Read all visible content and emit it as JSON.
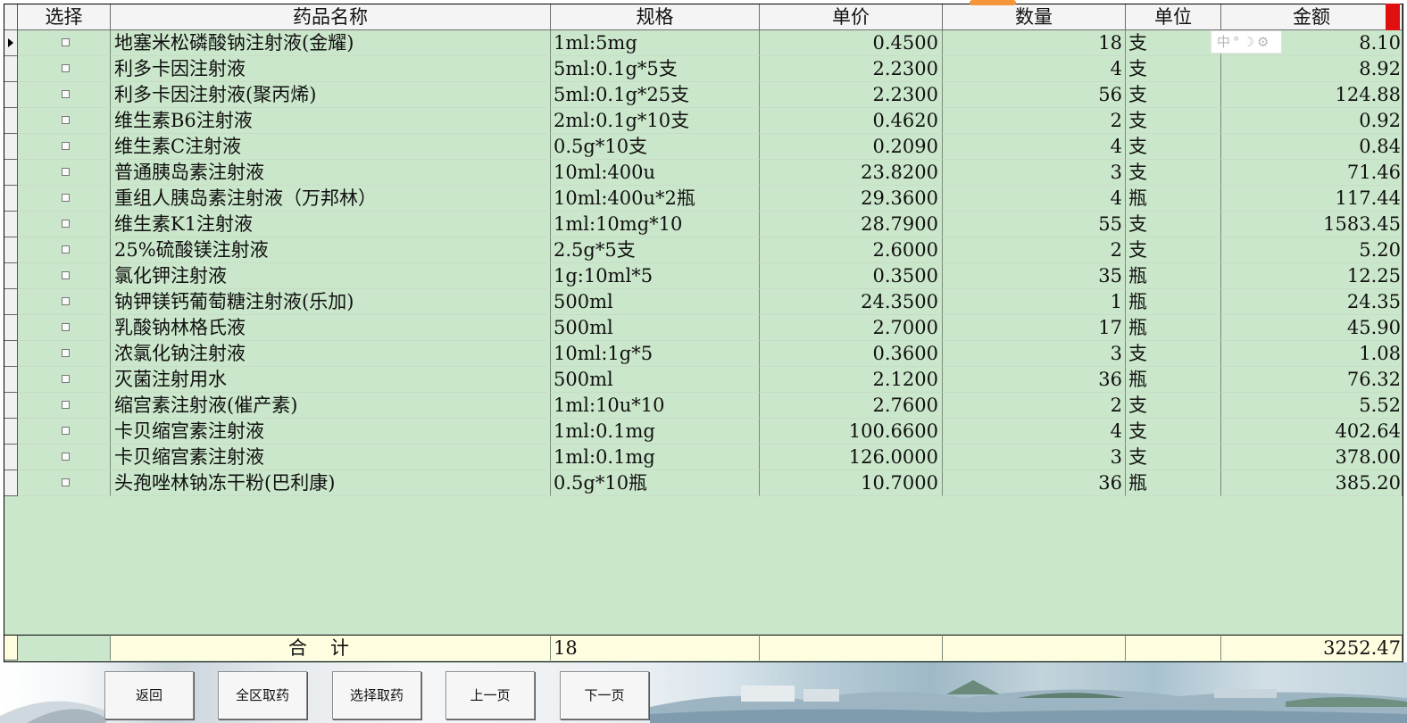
{
  "columns": {
    "select": "选择",
    "name": "药品名称",
    "spec": "规格",
    "price": "单价",
    "qty": "数量",
    "unit": "单位",
    "amount": "金额"
  },
  "rows": [
    {
      "name": "地塞米松磷酸钠注射液(金耀)",
      "spec": "1ml:5mg",
      "price": "0.4500",
      "qty": "18",
      "unit": "支",
      "amount": "8.10",
      "current": true
    },
    {
      "name": "利多卡因注射液",
      "spec": "5ml:0.1g*5支",
      "price": "2.2300",
      "qty": "4",
      "unit": "支",
      "amount": "8.92"
    },
    {
      "name": "利多卡因注射液(聚丙烯)",
      "spec": "5ml:0.1g*25支",
      "price": "2.2300",
      "qty": "56",
      "unit": "支",
      "amount": "124.88"
    },
    {
      "name": "维生素B6注射液",
      "spec": "2ml:0.1g*10支",
      "price": "0.4620",
      "qty": "2",
      "unit": "支",
      "amount": "0.92"
    },
    {
      "name": "维生素C注射液",
      "spec": "0.5g*10支",
      "price": "0.2090",
      "qty": "4",
      "unit": "支",
      "amount": "0.84"
    },
    {
      "name": "普通胰岛素注射液",
      "spec": "10ml:400u",
      "price": "23.8200",
      "qty": "3",
      "unit": "支",
      "amount": "71.46"
    },
    {
      "name": "重组人胰岛素注射液（万邦林）",
      "spec": "10ml:400u*2瓶",
      "price": "29.3600",
      "qty": "4",
      "unit": "瓶",
      "amount": "117.44"
    },
    {
      "name": "维生素K1注射液",
      "spec": "1ml:10mg*10",
      "price": "28.7900",
      "qty": "55",
      "unit": "支",
      "amount": "1583.45"
    },
    {
      "name": "25%硫酸镁注射液",
      "spec": "2.5g*5支",
      "price": "2.6000",
      "qty": "2",
      "unit": "支",
      "amount": "5.20"
    },
    {
      "name": "氯化钾注射液",
      "spec": "1g:10ml*5",
      "price": "0.3500",
      "qty": "35",
      "unit": "瓶",
      "amount": "12.25"
    },
    {
      "name": "钠钾镁钙葡萄糖注射液(乐加)",
      "spec": "500ml",
      "price": "24.3500",
      "qty": "1",
      "unit": "瓶",
      "amount": "24.35"
    },
    {
      "name": "乳酸钠林格氏液",
      "spec": "500ml",
      "price": "2.7000",
      "qty": "17",
      "unit": "瓶",
      "amount": "45.90"
    },
    {
      "name": "浓氯化钠注射液",
      "spec": "10ml:1g*5",
      "price": "0.3600",
      "qty": "3",
      "unit": "支",
      "amount": "1.08"
    },
    {
      "name": "灭菌注射用水",
      "spec": "500ml",
      "price": "2.1200",
      "qty": "36",
      "unit": "瓶",
      "amount": "76.32"
    },
    {
      "name": "缩宫素注射液(催产素)",
      "spec": "1ml:10u*10",
      "price": "2.7600",
      "qty": "2",
      "unit": "支",
      "amount": "5.52"
    },
    {
      "name": "卡贝缩宫素注射液",
      "spec": "1ml:0.1mg",
      "price": "100.6600",
      "qty": "4",
      "unit": "支",
      "amount": "402.64"
    },
    {
      "name": "卡贝缩宫素注射液",
      "spec": "1ml:0.1mg",
      "price": "126.0000",
      "qty": "3",
      "unit": "支",
      "amount": "378.00"
    },
    {
      "name": "头孢唑林钠冻干粉(巴利康)",
      "spec": "0.5g*10瓶",
      "price": "10.7000",
      "qty": "36",
      "unit": "瓶",
      "amount": "385.20"
    }
  ],
  "total": {
    "label": "合计",
    "count": "18",
    "amount": "3252.47"
  },
  "ime": {
    "mode": "中",
    "punct": "°",
    "moon": "☽",
    "gear": "⚙"
  },
  "buttons": {
    "back": "返回",
    "take_all": "全区取药",
    "take_selected": "选择取药",
    "prev_page": "上一页",
    "next_page": "下一页"
  },
  "colors": {
    "grid_bg": "#cbe7cb",
    "total_bg": "#fffde0",
    "header_bg": "#f4f4f4",
    "accent_red": "#e01010"
  }
}
